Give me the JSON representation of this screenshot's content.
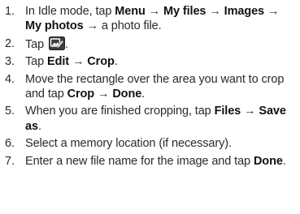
{
  "steps": [
    {
      "number": "1.",
      "parts": [
        {
          "t": "In Idle mode, tap "
        },
        {
          "t": "Menu",
          "b": true
        },
        {
          "t": " → "
        },
        {
          "t": "My files",
          "b": true
        },
        {
          "t": " → "
        },
        {
          "t": "Images",
          "b": true
        },
        {
          "t": " → "
        },
        {
          "t": "My photos",
          "b": true
        },
        {
          "t": " → a photo file."
        }
      ]
    },
    {
      "number": "2.",
      "parts": [
        {
          "t": "Tap "
        },
        {
          "icon": "edit-photo-icon"
        },
        {
          "t": "."
        }
      ]
    },
    {
      "number": "3.",
      "parts": [
        {
          "t": "Tap "
        },
        {
          "t": "Edit",
          "b": true
        },
        {
          "t": " → "
        },
        {
          "t": "Crop",
          "b": true
        },
        {
          "t": "."
        }
      ]
    },
    {
      "number": "4.",
      "parts": [
        {
          "t": "Move the rectangle over the area you want to crop and tap "
        },
        {
          "t": "Crop",
          "b": true
        },
        {
          "t": " → "
        },
        {
          "t": "Done",
          "b": true
        },
        {
          "t": "."
        }
      ]
    },
    {
      "number": "5.",
      "parts": [
        {
          "t": "When you are finished cropping, tap "
        },
        {
          "t": "Files",
          "b": true
        },
        {
          "t": " → "
        },
        {
          "t": "Save as",
          "b": true
        },
        {
          "t": "."
        }
      ]
    },
    {
      "number": "6.",
      "parts": [
        {
          "t": "Select a memory location (if necessary)."
        }
      ]
    },
    {
      "number": "7.",
      "parts": [
        {
          "t": "Enter a new file name for the image and tap "
        },
        {
          "t": "Done",
          "b": true
        },
        {
          "t": "."
        }
      ]
    }
  ],
  "colors": {
    "text": "#2a2a2a",
    "icon_bg": "#3d3d3d",
    "icon_fg": "#ffffff"
  }
}
